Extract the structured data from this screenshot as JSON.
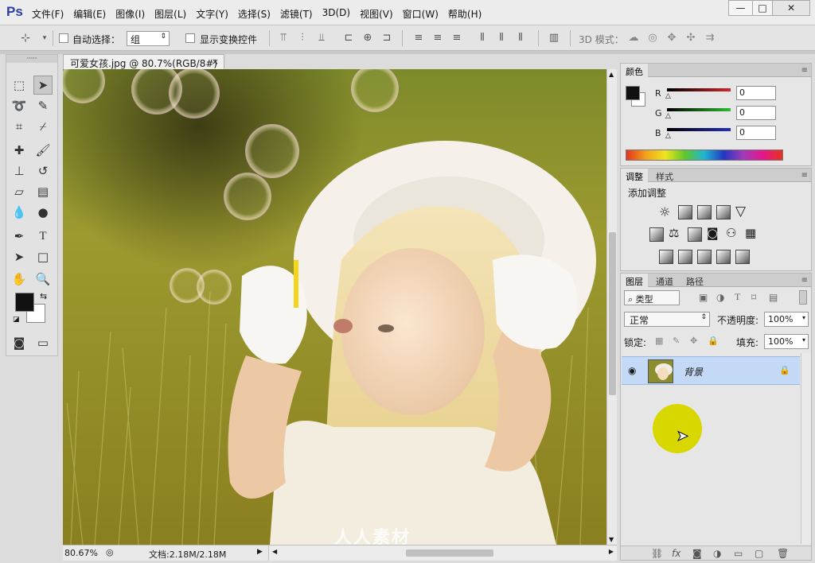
{
  "app": {
    "logo": "Ps"
  },
  "menu": [
    "文件(F)",
    "编辑(E)",
    "图像(I)",
    "图层(L)",
    "文字(Y)",
    "选择(S)",
    "滤镜(T)",
    "3D(D)",
    "视图(V)",
    "窗口(W)",
    "帮助(H)"
  ],
  "window_controls": {
    "minimize": "—",
    "restore": "□",
    "close": "✕"
  },
  "options": {
    "auto_select_label": "自动选择：",
    "auto_select_value": "组",
    "show_transform_label": "显示变换控件",
    "mode_3d_label": "3D 模式："
  },
  "document": {
    "tab_title": "可爱女孩.jpg @ 80.7%(RGB/8#)",
    "close_glyph": "×",
    "zoom": "80.67%",
    "doc_info": "文档:2.18M/2.18M"
  },
  "color_panel": {
    "tab": "颜色",
    "labels": [
      "R",
      "G",
      "B"
    ],
    "values": [
      "0",
      "0",
      "0"
    ],
    "slider_colors": [
      "#d8232a",
      "#2fba2f",
      "#2130b8"
    ]
  },
  "adjust_panel": {
    "tabs": [
      "调整",
      "样式"
    ],
    "title": "添加调整"
  },
  "layers_panel": {
    "tabs": [
      "图层",
      "通道",
      "路径"
    ],
    "kind_label": "类型",
    "blend_mode": "正常",
    "opacity_label": "不透明度:",
    "opacity_value": "100%",
    "lock_label": "锁定:",
    "fill_label": "填充:",
    "fill_value": "100%",
    "layer_name": "背景"
  },
  "watermark": "人人素材",
  "colors": {
    "accent_selected_row": "#c3d9f5",
    "cursor_highlight": "#d8d800"
  }
}
